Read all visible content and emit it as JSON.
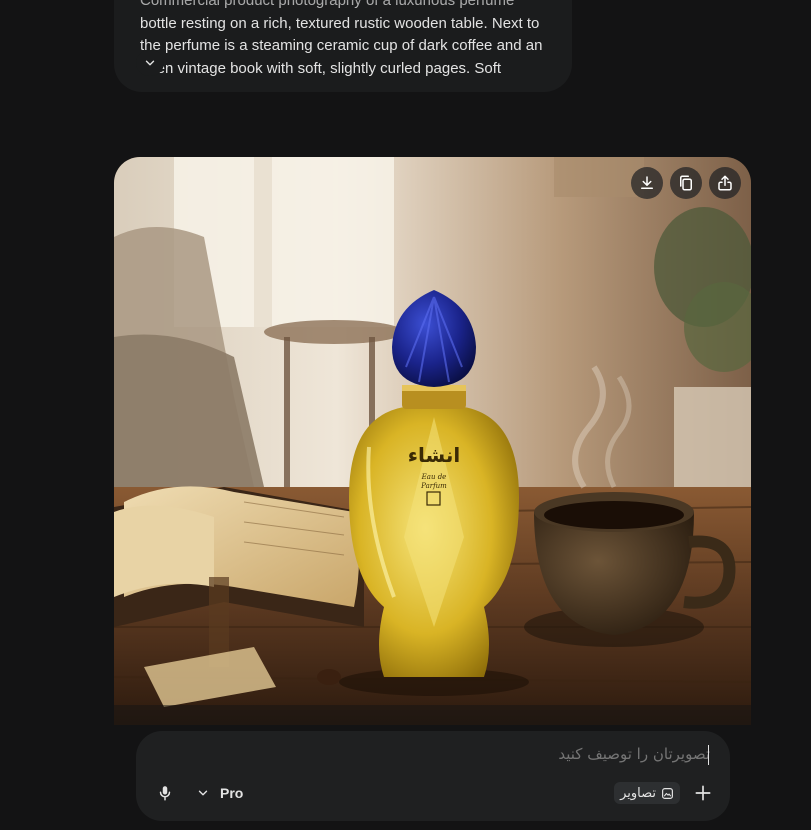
{
  "prompt": {
    "lines": [
      "Commercial product photography of a luxurious perfume",
      "bottle resting on a rich, textured rustic wooden table. Next to",
      "the perfume is a steaming ceramic cup of dark coffee and an",
      "open vintage book with soft, slightly curled pages. Soft"
    ],
    "expand_icon": "chevron-down-icon"
  },
  "image": {
    "bottle_label": {
      "brand": "انشاء",
      "line1": "Eau de",
      "line2": "Parfum"
    },
    "actions": [
      {
        "name": "download-button",
        "icon": "download-icon"
      },
      {
        "name": "copy-button",
        "icon": "copy-icon"
      },
      {
        "name": "share-button",
        "icon": "share-icon"
      }
    ]
  },
  "composer": {
    "placeholder": "تصویرتان را توصیف کنید",
    "model_label": "Pro",
    "chip_label": "تصاویر",
    "mic_icon": "mic-icon",
    "add_icon": "plus-icon"
  },
  "colors": {
    "background": "#131314",
    "surface": "#1f2021",
    "text": "#e3e3e3"
  }
}
